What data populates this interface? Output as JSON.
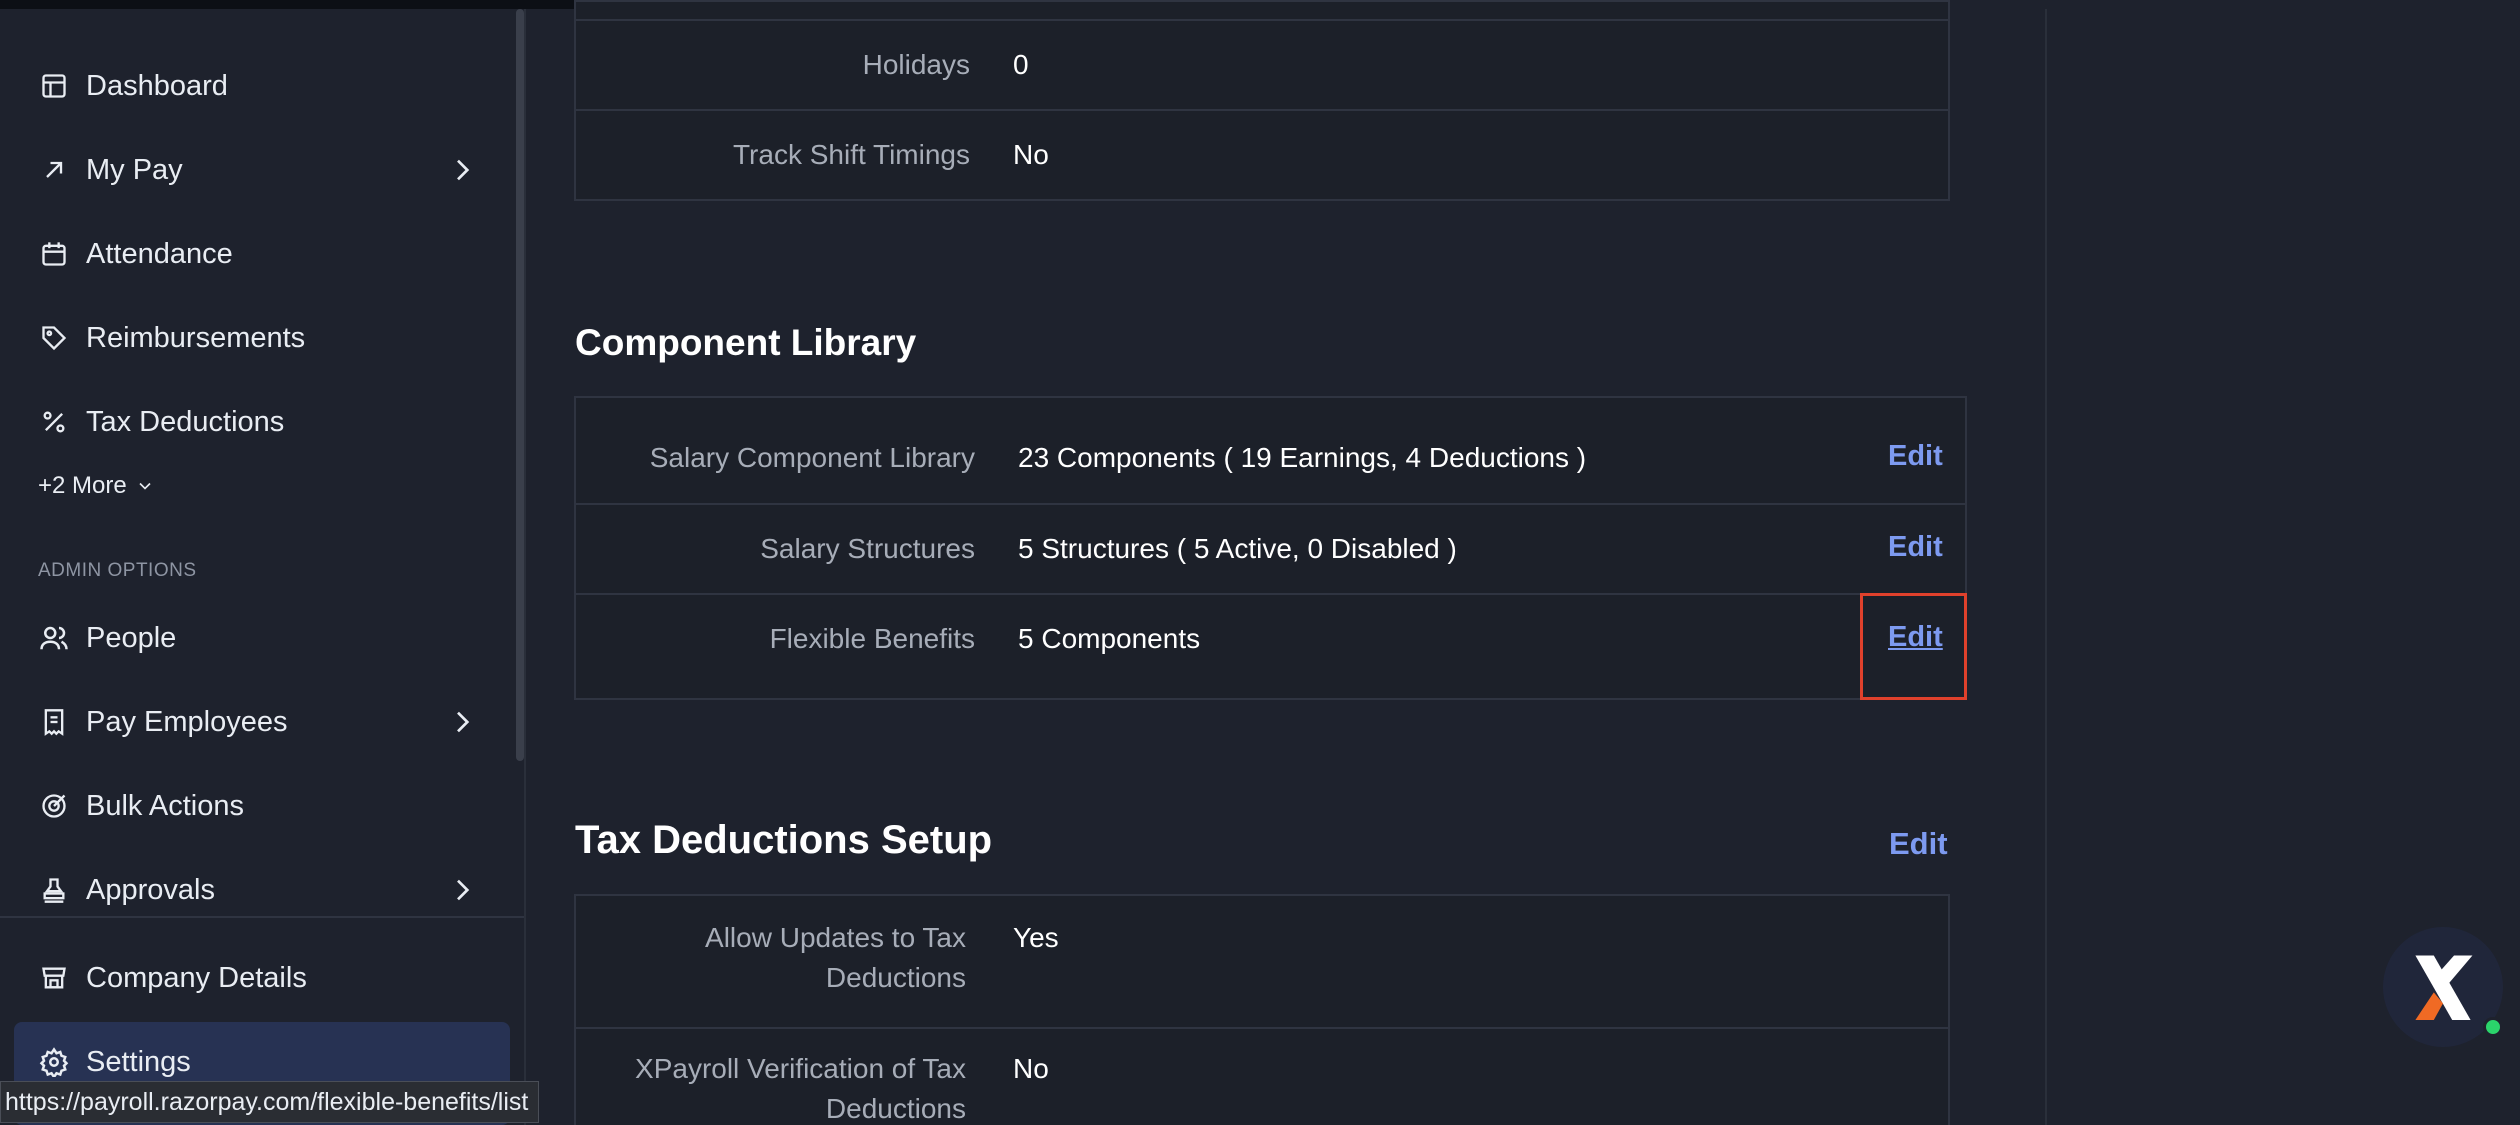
{
  "sidebar": {
    "items": [
      {
        "label": "Dashboard",
        "icon": "layout-icon"
      },
      {
        "label": "My Pay",
        "icon": "arrow-up-right-icon"
      },
      {
        "label": "Attendance",
        "icon": "calendar-icon"
      },
      {
        "label": "Reimbursements",
        "icon": "tag-icon"
      },
      {
        "label": "Tax Deductions",
        "icon": "percent-icon"
      }
    ],
    "more_label": "+2 More",
    "admin_section_label": "ADMIN OPTIONS",
    "admin_items": [
      {
        "label": "People",
        "icon": "users-icon"
      },
      {
        "label": "Pay Employees",
        "icon": "receipt-icon"
      },
      {
        "label": "Bulk Actions",
        "icon": "target-icon"
      },
      {
        "label": "Approvals",
        "icon": "stamp-icon"
      }
    ],
    "bottom_items": [
      {
        "label": "Company Details",
        "icon": "store-icon"
      },
      {
        "label": "Settings",
        "icon": "gear-icon"
      }
    ]
  },
  "attendance_card": {
    "rows": [
      {
        "label": "Holidays",
        "value": "0"
      },
      {
        "label": "Track Shift Timings",
        "value": "No"
      }
    ]
  },
  "component_library": {
    "title": "Component Library",
    "rows": [
      {
        "label": "Salary Component Library",
        "value": "23 Components ( 19 Earnings, 4 Deductions )",
        "action": "Edit"
      },
      {
        "label": "Salary Structures",
        "value": "5 Structures ( 5 Active, 0 Disabled )",
        "action": "Edit"
      },
      {
        "label": "Flexible Benefits",
        "value": "5 Components",
        "action": "Edit"
      }
    ]
  },
  "tax_setup": {
    "title": "Tax Deductions Setup",
    "action": "Edit",
    "rows": [
      {
        "label_line1": "Allow Updates to Tax",
        "label_line2": "Deductions",
        "value": "Yes"
      },
      {
        "label_line1": "XPayroll Verification of Tax",
        "label_line2": "Deductions",
        "value": "No"
      }
    ]
  },
  "status_url": "https://payroll.razorpay.com/flexible-benefits/list",
  "colors": {
    "accent": "#7d9af0",
    "highlight": "#e0412c",
    "active_nav": "#273253",
    "fab_orange": "#f06a24"
  }
}
